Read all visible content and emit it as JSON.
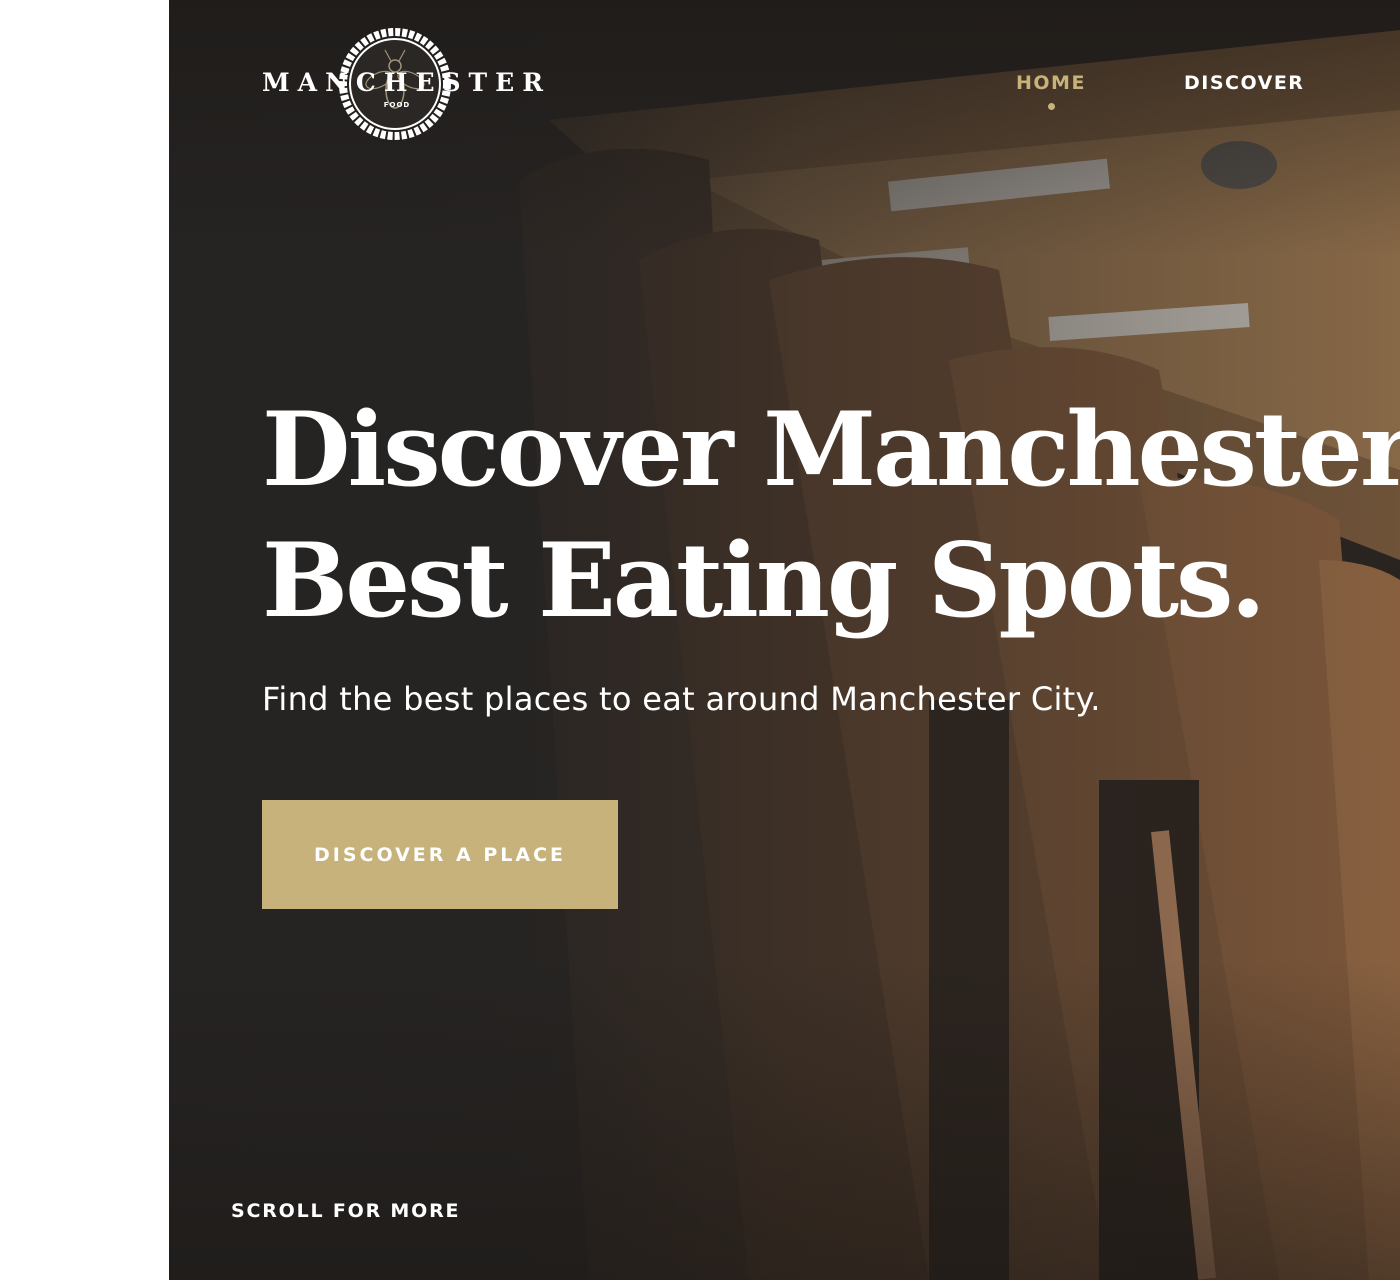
{
  "logo": {
    "wordmark": "MANCHESTER",
    "sub": "FOOD",
    "icon": "bee-emblem-icon"
  },
  "nav": {
    "items": [
      {
        "label": "HOME",
        "active": true
      },
      {
        "label": "DISCOVER",
        "active": false
      }
    ]
  },
  "hero": {
    "headline_line1": "Discover Manchester’s",
    "headline_line2": "Best Eating Spots.",
    "subtitle": "Find the best places to eat around Manchester City.",
    "cta_label": "DISCOVER A PLACE",
    "scroll_label": "SCROLL FOR MORE",
    "background_image": "restaurant-tables-and-wooden-chairs"
  },
  "colors": {
    "accent": "#c6b27a",
    "hero_dark": "#262423",
    "text": "#ffffff",
    "page_background": "#ffffff"
  }
}
